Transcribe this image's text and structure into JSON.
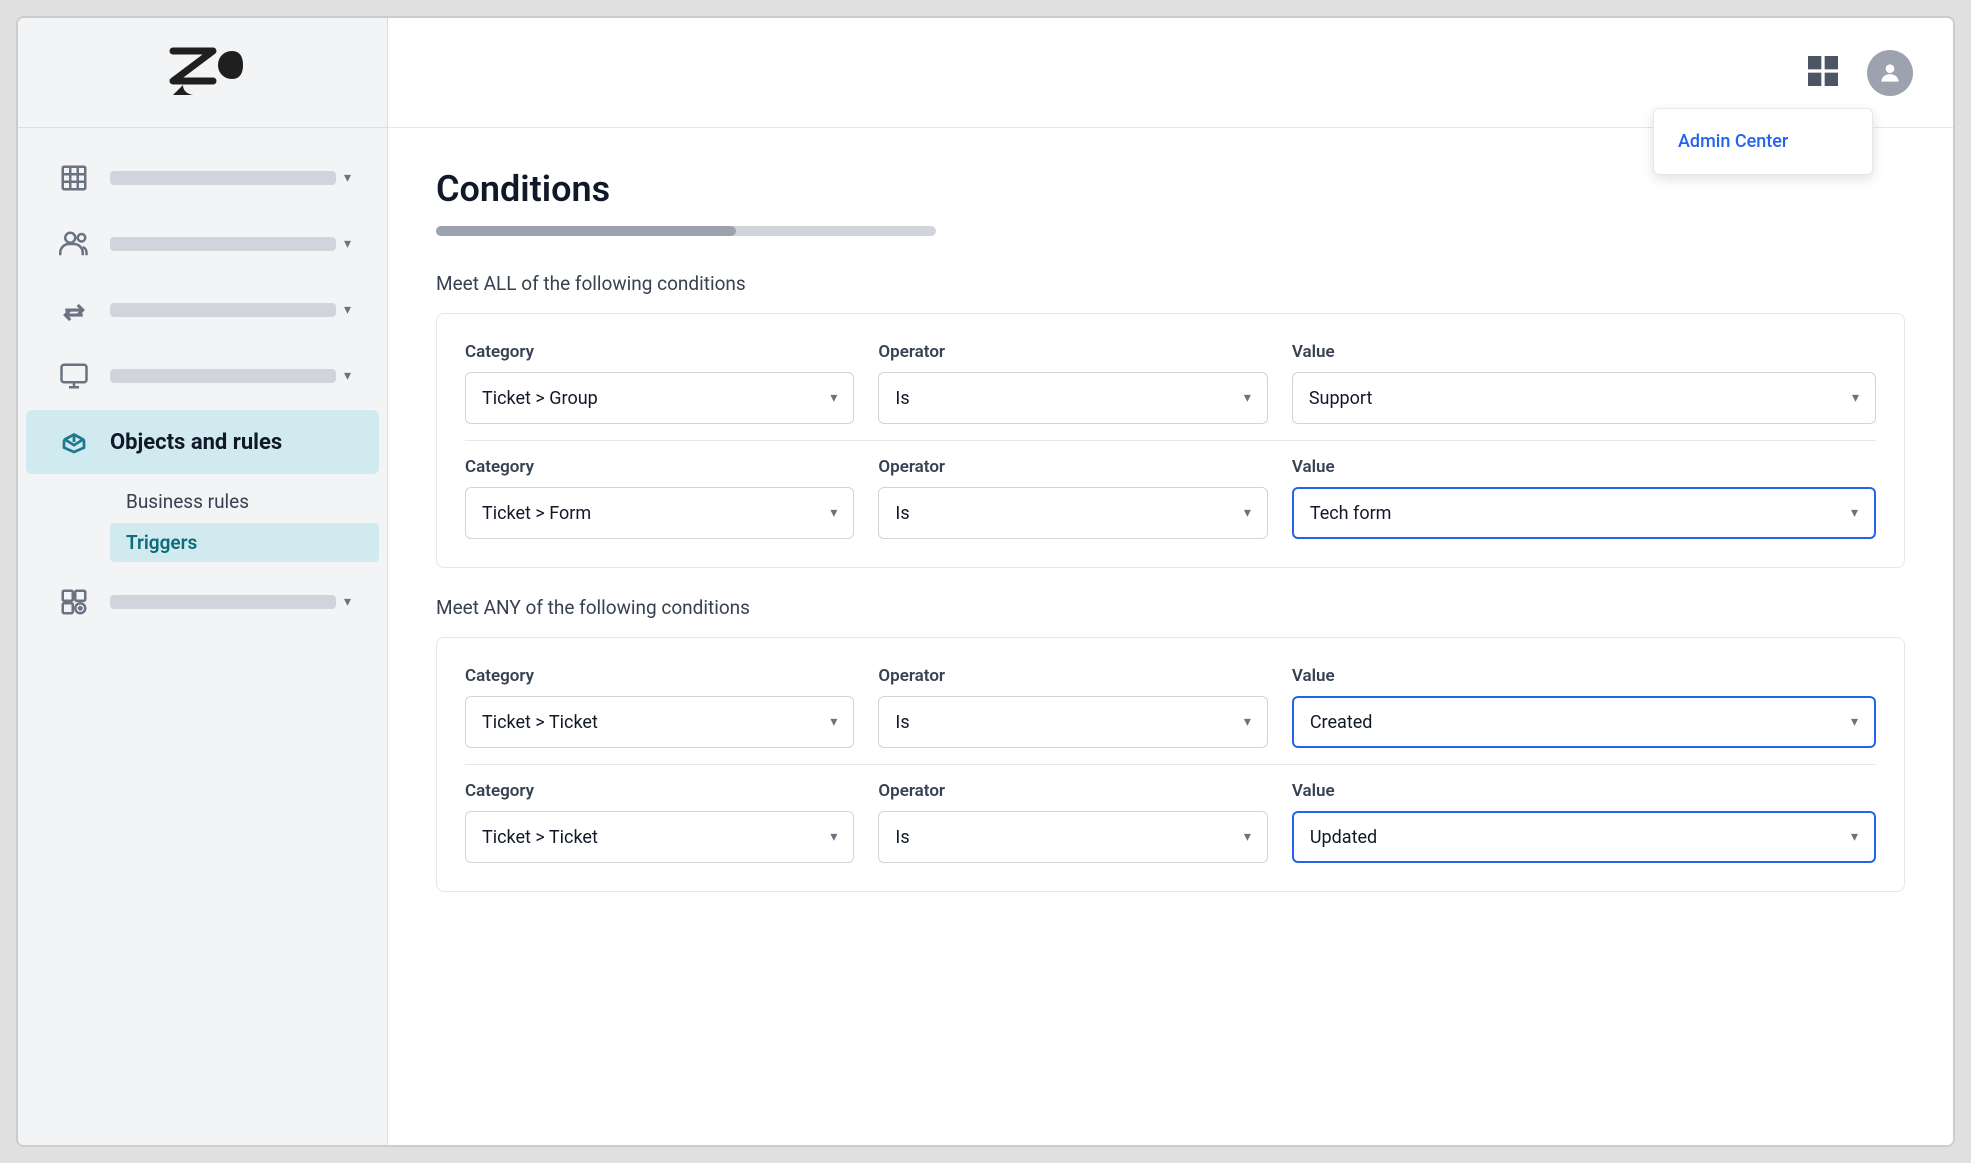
{
  "logo": {
    "alt": "Zendesk"
  },
  "topbar": {
    "admin_center_label": "Admin Center"
  },
  "sidebar": {
    "nav_items": [
      {
        "id": "building",
        "icon": "building",
        "active": false,
        "has_chevron": true
      },
      {
        "id": "people",
        "icon": "people",
        "active": false,
        "has_chevron": true
      },
      {
        "id": "arrows",
        "icon": "arrows",
        "active": false,
        "has_chevron": true
      },
      {
        "id": "monitor",
        "icon": "monitor",
        "active": false,
        "has_chevron": true
      },
      {
        "id": "objects",
        "icon": "objects",
        "label": "Objects and rules",
        "active": true,
        "has_chevron": false
      },
      {
        "id": "apps",
        "icon": "apps",
        "active": false,
        "has_chevron": true
      }
    ],
    "submenu": {
      "parent_label": "Business rules",
      "items": [
        {
          "id": "triggers",
          "label": "Triggers",
          "active": true
        }
      ]
    }
  },
  "page": {
    "title": "Conditions",
    "progress_pct": 60,
    "all_conditions_label": "Meet ALL of the following conditions",
    "any_conditions_label": "Meet ANY of the following conditions",
    "all_conditions": [
      {
        "category_label": "Category",
        "category_value": "Ticket > Group",
        "operator_label": "Operator",
        "operator_value": "Is",
        "value_label": "Value",
        "value_value": "Support",
        "value_focused": false
      },
      {
        "category_label": "Category",
        "category_value": "Ticket > Form",
        "operator_label": "Operator",
        "operator_value": "Is",
        "value_label": "Value",
        "value_value": "Tech form",
        "value_focused": true
      }
    ],
    "any_conditions": [
      {
        "category_label": "Category",
        "category_value": "Ticket > Ticket",
        "operator_label": "Operator",
        "operator_value": "Is",
        "value_label": "Value",
        "value_value": "Created",
        "value_focused": true
      },
      {
        "category_label": "Category",
        "category_value": "Ticket > Ticket",
        "operator_label": "Operator",
        "operator_value": "Is",
        "value_label": "Value",
        "value_value": "Updated",
        "value_focused": true
      }
    ]
  }
}
